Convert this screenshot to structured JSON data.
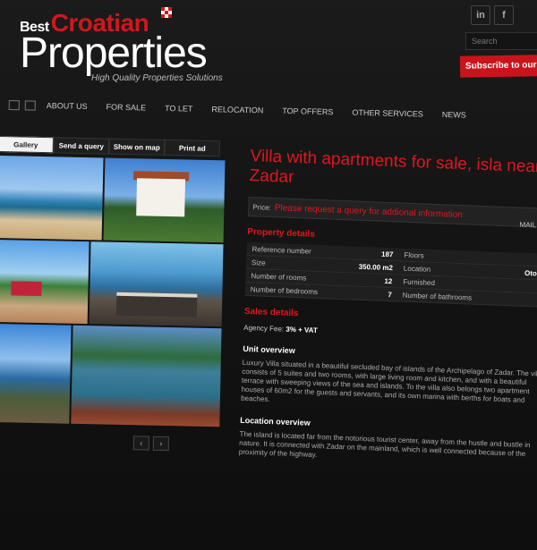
{
  "logo": {
    "best": "Best",
    "croatian": "Croatian",
    "properties": "Properties",
    "tagline": "High Quality Properties Solutions"
  },
  "social": {
    "linkedin": "in",
    "facebook": "f"
  },
  "search": {
    "placeholder": "Search"
  },
  "subscribe": {
    "label": "Subscribe to our"
  },
  "nav": {
    "items": [
      "ABOUT US",
      "FOR SALE",
      "TO LET",
      "RELOCATION",
      "TOP OFFERS",
      "OTHER SERVICES",
      "NEWS"
    ]
  },
  "gallery": {
    "tabs": [
      "Gallery",
      "Send a query",
      "Show on map",
      "Print ad"
    ],
    "prev": "‹",
    "next": "›"
  },
  "listing": {
    "title": "Villa with apartments for sale, isla near Zadar",
    "price_label": "Price:",
    "price_value": "Please request a query for addional information",
    "mail": "MAIL T",
    "property_details_heading": "Property details",
    "details_left": [
      {
        "label": "Reference number",
        "value": "187"
      },
      {
        "label": "Size",
        "value": "350.00 m2"
      },
      {
        "label": "Number of rooms",
        "value": "12"
      },
      {
        "label": "Number of bedrooms",
        "value": "7"
      }
    ],
    "details_right": [
      {
        "label": "Floors",
        "value": ""
      },
      {
        "label": "Location",
        "value": "Otoče"
      },
      {
        "label": "Furnished",
        "value": ""
      },
      {
        "label": "Number of bathrooms",
        "value": ""
      }
    ],
    "sales_heading": "Sales details",
    "agency_label": "Agency Fee:",
    "agency_value": "3% + VAT",
    "unit_heading": "Unit overview",
    "unit_text": "Luxury Villa situated in a beautiful secluded bay of islands of the Archipelago of Zadar. The villa consists of 5 suites and two rooms, with large living room and kitchen, and with a beautiful terrace with sweeping views of the sea and islands. To the villa also belongs two apartment houses of 60m2 for the guests and servants, and its own marina with berths for boats and beaches.",
    "location_heading": "Location overview",
    "location_text": "The island is located far from the notorious tourist center, away from the hustle and bustle in nature. It is connected with Zadar on the mainland, which is well connected because of the proximity of the highway."
  },
  "colors": {
    "accent": "#e0161f",
    "subscribe_bg": "#c9141c",
    "background": "#111111"
  }
}
